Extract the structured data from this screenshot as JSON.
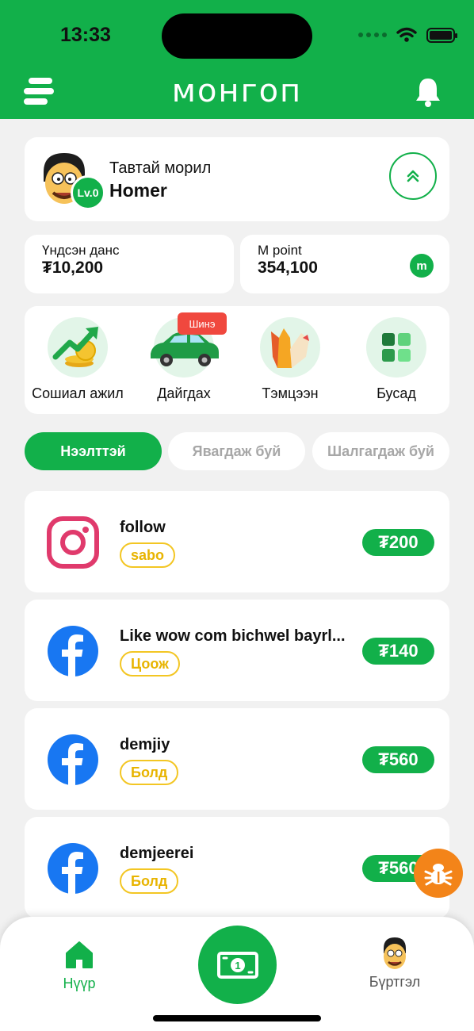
{
  "status_bar": {
    "time": "13:33"
  },
  "header": {
    "logo": "монгоп"
  },
  "profile": {
    "greeting": "Тавтай морил",
    "name": "Homer",
    "level": "Lv.0"
  },
  "balances": {
    "main": {
      "label": "Үндсэн данс",
      "value": "₮10,200"
    },
    "points": {
      "label": "M point",
      "value": "354,100",
      "icon": "m"
    }
  },
  "categories": [
    {
      "label": "Сошиал ажил",
      "icon": "social-growth-icon"
    },
    {
      "label": "Дайгдах",
      "icon": "car-icon",
      "badge": "Шинэ"
    },
    {
      "label": "Тэмцээн",
      "icon": "competition-icon"
    },
    {
      "label": "Бусад",
      "icon": "grid-icon"
    }
  ],
  "tabs": [
    {
      "label": "Нээлттэй",
      "active": true
    },
    {
      "label": "Явагдаж буй",
      "active": false
    },
    {
      "label": "Шалгагдаж буй",
      "active": false
    }
  ],
  "tasks": [
    {
      "platform": "instagram",
      "title": "follow",
      "tag": "sabo",
      "price": "₮200"
    },
    {
      "platform": "facebook",
      "title": "Like wow com bichwel bayrl...",
      "tag": "Цоож",
      "price": "₮140"
    },
    {
      "platform": "facebook",
      "title": "demjiy",
      "tag": "Болд",
      "price": "₮560"
    },
    {
      "platform": "facebook",
      "title": "demjeerei",
      "tag": "Болд",
      "price": "₮560"
    }
  ],
  "bottom_nav": {
    "home": "Нүүр",
    "profile": "Бүртгэл"
  },
  "colors": {
    "brand_green": "#12b04a",
    "tag_yellow": "#f3c623",
    "badge_red": "#f0483e",
    "bug_orange": "#f38419"
  }
}
